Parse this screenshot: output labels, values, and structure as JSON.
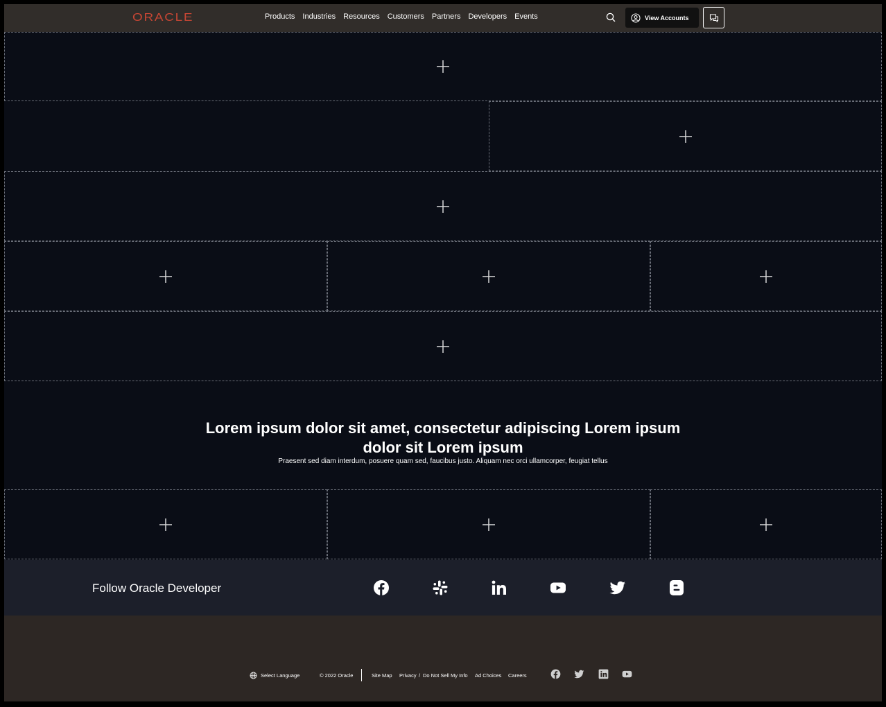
{
  "header": {
    "logo_text": "ORACLE",
    "nav": [
      "Products",
      "Industries",
      "Resources",
      "Customers",
      "Partners",
      "Developers",
      "Events"
    ],
    "view_accounts_label": "View Accounts"
  },
  "colors": {
    "header_bg": "#312d2a",
    "page_bg": "#0a0d16",
    "brand_red": "#c74634",
    "follow_bg": "#1c1f2a",
    "footer_bg": "#2d2724"
  },
  "content": {
    "headline": "Lorem ipsum dolor sit amet, consectetur adipiscing Lorem ipsum dolor sit Lorem ipsum",
    "subline": "Praesent sed diam interdum, posuere quam sed, faucibus justo. Aliquam nec orci ullamcorper, feugiat tellus"
  },
  "follow": {
    "title": "Follow Oracle Developer",
    "icons": [
      "facebook-icon",
      "slack-icon",
      "linkedin-icon",
      "youtube-icon",
      "twitter-icon",
      "blogger-icon"
    ]
  },
  "footer": {
    "select_language": "Select Language",
    "copyright": "© 2022 Oracle",
    "site_map": "Site Map",
    "privacy": "Privacy",
    "privacy_sep": "/",
    "do_not_sell": "Do Not Sell My Info",
    "ad_choices": "Ad Choices",
    "careers": "Careers",
    "icons": [
      "facebook-icon",
      "twitter-icon",
      "linkedin-icon",
      "youtube-icon"
    ]
  }
}
